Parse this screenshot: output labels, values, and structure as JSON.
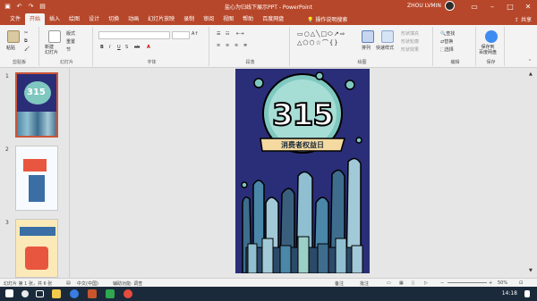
{
  "title_bar": {
    "document_title": "盐心为归线下展示PPT - PowerPoint",
    "user_name": "ZHOU LVMIN"
  },
  "tabs": [
    "文件",
    "开始",
    "插入",
    "绘图",
    "设计",
    "切换",
    "动画",
    "幻灯片放映",
    "录制",
    "审阅",
    "视图",
    "帮助",
    "百度网盘"
  ],
  "active_tab": "开始",
  "search_placeholder": "操作说明搜索",
  "share_label": "共享",
  "ribbon": {
    "clipboard": {
      "paste": "粘贴",
      "label": "剪贴板"
    },
    "slides": {
      "new_slide": "新建\n幻灯片",
      "layout": "版式",
      "reset": "重置",
      "section": "节",
      "label": "幻灯片"
    },
    "font": {
      "label": "字体",
      "font_name": "",
      "font_size": ""
    },
    "paragraph": {
      "label": "段落"
    },
    "drawing": {
      "arrange": "排列",
      "quick_styles": "快速样式",
      "shape_fill": "形状填充",
      "shape_outline": "形状轮廓",
      "shape_effects": "形状效果",
      "label": "绘图"
    },
    "editing": {
      "find": "查找",
      "replace": "替换",
      "select": "选择",
      "label": "编辑"
    },
    "save": {
      "save_to_baidu": "保存到\n百度网盘",
      "label": "保存"
    }
  },
  "slides": [
    {
      "number": "1",
      "selected": true
    },
    {
      "number": "2",
      "selected": false
    },
    {
      "number": "3",
      "selected": false
    }
  ],
  "slide_content": {
    "big_number": "315",
    "banner_text": "消费者权益日"
  },
  "status": {
    "slide_info": "幻灯片 第 1 张，共 6 张",
    "language": "中文(中国)",
    "accessibility": "辅助功能: 调查",
    "notes": "备注",
    "comments": "批注",
    "zoom": "50%"
  },
  "taskbar": {
    "time": "14:18"
  },
  "colors": {
    "accent": "#b7472a",
    "slide_bg": "#2a2e78",
    "circle": "#7fc8c0",
    "banner": "#f4d9a0"
  }
}
